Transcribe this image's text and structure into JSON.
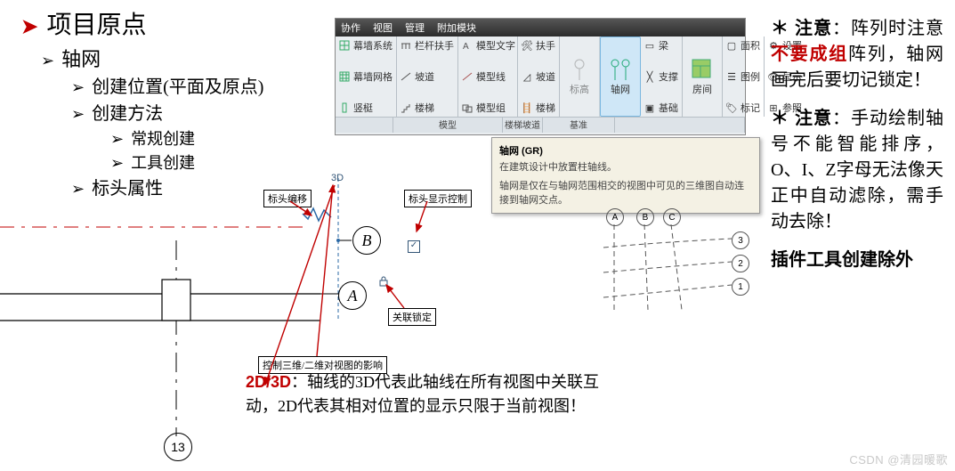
{
  "outline": {
    "title": "项目原点",
    "i1": "轴网",
    "i2a": "创建位置(平面及原点)",
    "i2b": "创建方法",
    "i3a": "常规创建",
    "i3b": "工具创建",
    "i2c": "标头属性"
  },
  "diagram": {
    "bubble_num": "13"
  },
  "center": {
    "bubble_a": "A",
    "bubble_b": "B",
    "tag_head_edit": "标头编移",
    "tag_head_ctrl": "标头显示控制",
    "tag_assoc_lock": "关联锁定",
    "tag_3d2d": "控制三维/二维对视图的影响",
    "txt_3d": "3D",
    "check": "✓"
  },
  "note23": {
    "head": "2D/3D",
    "body1": "：轴线的3D代表此轴线在所有视图中关联互动，2D代表其相对位置的显示只限于当前视图！"
  },
  "ribbon": {
    "tabs": [
      "协作",
      "视图",
      "管理",
      "附加模块"
    ],
    "c1": [
      "幕墙系统",
      "幕墙网格",
      "竖梃"
    ],
    "c2": [
      "栏杆扶手",
      "坡道",
      "楼梯"
    ],
    "c3": [
      "模型文字",
      "模型线",
      "模型组"
    ],
    "c4": [
      "扶手",
      "坡道",
      "楼梯"
    ],
    "c5_big": "标高",
    "c6_big": "轴网",
    "c7": [
      "梁",
      "支撑",
      "基础"
    ],
    "c8_big": "房间",
    "c9": [
      "面积",
      "图例",
      "标记"
    ],
    "c10": [
      "设置",
      "显示",
      "参照"
    ],
    "panel_labels": [
      "",
      "模型",
      "楼梯坡道",
      "基准",
      "",
      "",
      ""
    ]
  },
  "tooltip": {
    "title": "轴网 (GR)",
    "line1": "在建筑设计中放置柱轴线。",
    "line2": "轴网是仅在与轴网范围相交的视图中可见的三维图自动连接到轴网交点。"
  },
  "smallgrid": {
    "a": "A",
    "b": "B",
    "c": "C",
    "n1": "1",
    "n2": "2",
    "n3": "3"
  },
  "rnotes": {
    "p1a": "＊ 注意",
    "p1b": "：阵列时注意",
    "p1c": "不要成组",
    "p1d": "阵列，轴网画完后要切记锁定！",
    "p2a": "＊ 注意",
    "p2b": "：手动绘制轴号不能智能排序，O、I、Z字母无法像天正中自动滤除，需手动去除！",
    "p3": "插件工具创建除外"
  },
  "watermark": "CSDN @清园暖歌"
}
